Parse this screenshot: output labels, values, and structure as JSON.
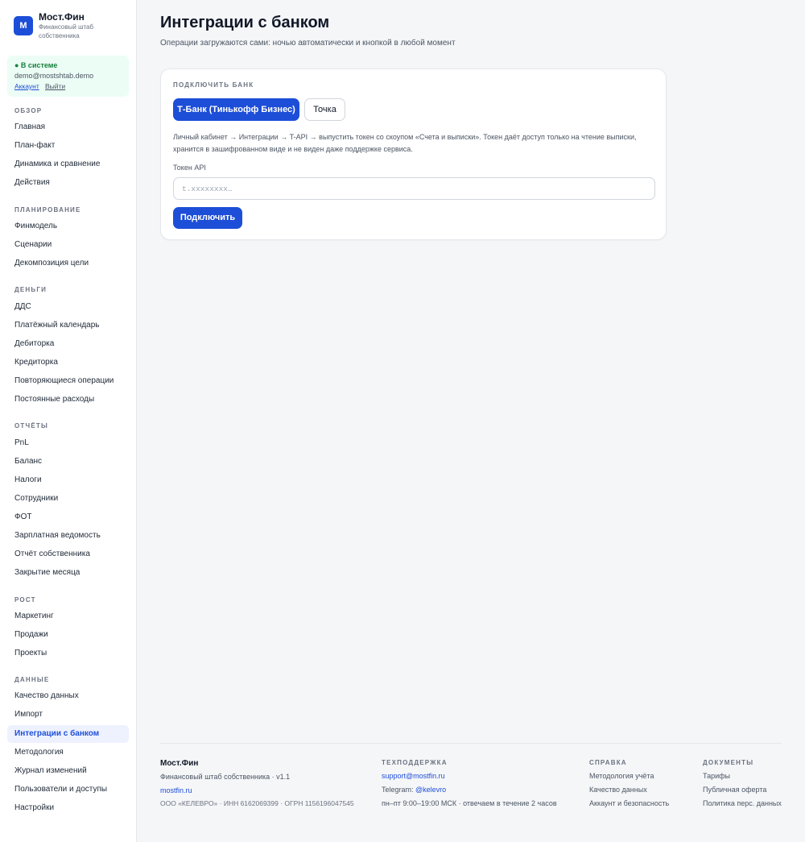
{
  "brand": {
    "logo_letter": "M",
    "name": "Мост.Фин",
    "tagline": "Финансовый штаб собственника"
  },
  "session": {
    "status": "● В системе",
    "email": "demo@mostshtab.demo",
    "account_link": "Аккаунт",
    "logout_link": "Выйти"
  },
  "sidebar": {
    "sections": [
      {
        "title": "ОБЗОР",
        "items": [
          "Главная",
          "План-факт",
          "Динамика и сравнение",
          "Действия"
        ]
      },
      {
        "title": "ПЛАНИРОВАНИЕ",
        "items": [
          "Финмодель",
          "Сценарии",
          "Декомпозиция цели"
        ]
      },
      {
        "title": "ДЕНЬГИ",
        "items": [
          "ДДС",
          "Платёжный календарь",
          "Дебиторка",
          "Кредиторка",
          "Повторяющиеся операции",
          "Постоянные расходы"
        ]
      },
      {
        "title": "ОТЧЁТЫ",
        "items": [
          "PnL",
          "Баланс",
          "Налоги",
          "Сотрудники",
          "ФОТ",
          "Зарплатная ведомость",
          "Отчёт собственника",
          "Закрытие месяца"
        ]
      },
      {
        "title": "РОСТ",
        "items": [
          "Маркетинг",
          "Продажи",
          "Проекты"
        ]
      },
      {
        "title": "ДАННЫЕ",
        "items": [
          "Качество данных",
          "Импорт",
          "Интеграции с банком",
          "Методология",
          "Журнал изменений",
          "Пользователи и доступы",
          "Настройки"
        ]
      }
    ],
    "active_item": "Интеграции с банком"
  },
  "page": {
    "title": "Интеграции с банком",
    "subtitle": "Операции загружаются сами: ночью автоматически и кнопкой в любой момент"
  },
  "connect_card": {
    "label": "ПОДКЛЮЧИТЬ БАНК",
    "bank_selected": "Т-Банк (Тинькофф Бизнес)",
    "bank_other": "Точка",
    "description": "Личный кабинет → Интеграции → T-API → выпустить токен со скоупом «Счета и выписки». Токен даёт доступ только на чтение выписки, хранится в зашифрованном виде и не виден даже поддержке сервиса.",
    "token_label": "Токен API",
    "token_value": "",
    "token_placeholder": "t.xxxxxxxx…",
    "connect_button": "Подключить"
  },
  "footer": {
    "brand": "Мост.Фин",
    "tagline": "Финансовый штаб собственника · v1.1",
    "site": "mostfin.ru",
    "legal": "ООО «КЕЛЕВРО» · ИНН 6162069399 · ОГРН 1156196047545",
    "support": {
      "title": "ТЕХПОДДЕРЖКА",
      "email": "support@mostfin.ru",
      "telegram_label": "Telegram:",
      "telegram_handle": "@kelevro",
      "hours": "пн–пт 9:00–19:00 МСК · отвечаем в течение 2 часов"
    },
    "help": {
      "title": "СПРАВКА",
      "links": [
        "Методология учёта",
        "Качество данных",
        "Аккаунт и безопасность"
      ]
    },
    "docs": {
      "title": "ДОКУМЕНТЫ",
      "links": [
        "Тарифы",
        "Публичная оферта",
        "Политика перс. данных"
      ]
    }
  },
  "colors": {
    "accent": "#1d4ed8",
    "status_green": "#15803d",
    "session_bg": "#ecfdf5",
    "active_bg": "#eef2ff"
  }
}
